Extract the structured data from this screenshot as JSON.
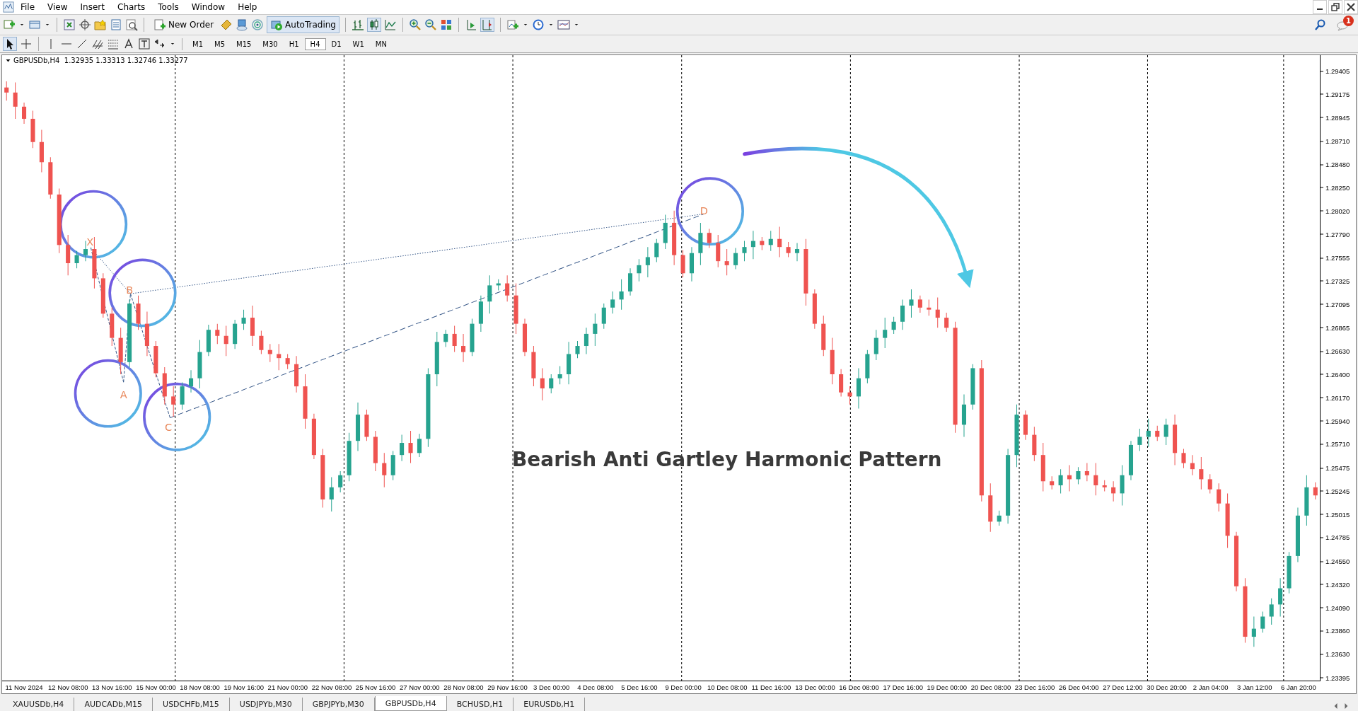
{
  "menu": [
    {
      "label": "File"
    },
    {
      "label": "View"
    },
    {
      "label": "Insert"
    },
    {
      "label": "Charts"
    },
    {
      "label": "Tools"
    },
    {
      "label": "Window"
    },
    {
      "label": "Help"
    }
  ],
  "toolbar": {
    "new_order": "New Order",
    "auto_trading": "AutoTrading"
  },
  "notification_badge": "1",
  "timeframes": [
    {
      "label": "M1",
      "selected": false
    },
    {
      "label": "M5",
      "selected": false
    },
    {
      "label": "M15",
      "selected": false
    },
    {
      "label": "M30",
      "selected": false
    },
    {
      "label": "H1",
      "selected": false
    },
    {
      "label": "H4",
      "selected": true
    },
    {
      "label": "D1",
      "selected": false
    },
    {
      "label": "W1",
      "selected": false
    },
    {
      "label": "MN",
      "selected": false
    }
  ],
  "chart": {
    "header": "GBPUSDb,H4  1.32935 1.33313 1.32746 1.33277",
    "title": "Bearish Anti Gartley Harmonic Pattern",
    "pattern_points": [
      {
        "label": "X"
      },
      {
        "label": "A"
      },
      {
        "label": "B"
      },
      {
        "label": "C"
      },
      {
        "label": "D"
      }
    ],
    "chart_data": {
      "type": "candlestick",
      "ylim": [
        1.23366,
        1.2956
      ],
      "yticks": [
        {
          "value": 1.29405,
          "label": "1.29405"
        },
        {
          "value": 1.29175,
          "label": "1.29175"
        },
        {
          "value": 1.28945,
          "label": "1.28945"
        },
        {
          "value": 1.2871,
          "label": "1.28710"
        },
        {
          "value": 1.2848,
          "label": "1.28480"
        },
        {
          "value": 1.2825,
          "label": "1.28250"
        },
        {
          "value": 1.2802,
          "label": "1.28020"
        },
        {
          "value": 1.2779,
          "label": "1.27790"
        },
        {
          "value": 1.27555,
          "label": "1.27555"
        },
        {
          "value": 1.27325,
          "label": "1.27325"
        },
        {
          "value": 1.27095,
          "label": "1.27095"
        },
        {
          "value": 1.26865,
          "label": "1.26865"
        },
        {
          "value": 1.2663,
          "label": "1.26630"
        },
        {
          "value": 1.264,
          "label": "1.26400"
        },
        {
          "value": 1.2617,
          "label": "1.26170"
        },
        {
          "value": 1.2594,
          "label": "1.25940"
        },
        {
          "value": 1.2571,
          "label": "1.25710"
        },
        {
          "value": 1.25475,
          "label": "1.25475"
        },
        {
          "value": 1.25245,
          "label": "1.25245"
        },
        {
          "value": 1.25015,
          "label": "1.25015"
        },
        {
          "value": 1.24785,
          "label": "1.24785"
        },
        {
          "value": 1.2455,
          "label": "1.24550"
        },
        {
          "value": 1.2432,
          "label": "1.24320"
        },
        {
          "value": 1.2409,
          "label": "1.24090"
        },
        {
          "value": 1.2386,
          "label": "1.23860"
        },
        {
          "value": 1.2363,
          "label": "1.23630"
        },
        {
          "value": 1.23395,
          "label": "1.23395"
        }
      ],
      "categories": [
        null,
        null,
        "11 Nov 2024",
        null,
        null,
        null,
        null,
        "12 Nov 08:00",
        null,
        null,
        null,
        null,
        "13 Nov 16:00",
        null,
        null,
        null,
        null,
        "15 Nov 00:00",
        null,
        null,
        null,
        null,
        "18 Nov 08:00",
        null,
        null,
        null,
        null,
        "19 Nov 16:00",
        null,
        null,
        null,
        null,
        "21 Nov 00:00",
        null,
        null,
        null,
        null,
        "22 Nov 08:00",
        null,
        null,
        null,
        null,
        "25 Nov 16:00",
        null,
        null,
        null,
        null,
        "27 Nov 00:00",
        null,
        null,
        null,
        null,
        "28 Nov 08:00",
        null,
        null,
        null,
        null,
        "29 Nov 16:00",
        null,
        null,
        null,
        null,
        "3 Dec 00:00",
        null,
        null,
        null,
        null,
        "4 Dec 08:00",
        null,
        null,
        null,
        null,
        "5 Dec 16:00",
        null,
        null,
        null,
        null,
        "9 Dec 00:00",
        null,
        null,
        null,
        null,
        "10 Dec 08:00",
        null,
        null,
        null,
        null,
        "11 Dec 16:00",
        null,
        null,
        null,
        null,
        "13 Dec 00:00",
        null,
        null,
        null,
        null,
        "16 Dec 08:00",
        null,
        null,
        null,
        null,
        "17 Dec 16:00",
        null,
        null,
        null,
        null,
        "19 Dec 00:00",
        null,
        null,
        null,
        null,
        "20 Dec 08:00",
        null,
        null,
        null,
        null,
        "23 Dec 16:00",
        null,
        null,
        null,
        null,
        "26 Dec 04:00",
        null,
        null,
        null,
        null,
        "27 Dec 12:00",
        null,
        null,
        null,
        null,
        "30 Dec 20:00",
        null,
        null,
        null,
        null,
        "2 Jan 04:00",
        null,
        null,
        null,
        null,
        "3 Jan 12:00",
        null,
        null,
        null,
        null,
        "6 Jan 20:00",
        null,
        null
      ],
      "ohlc": [
        [
          1.2924,
          1.293,
          1.2911,
          1.2919
        ],
        [
          1.2919,
          1.2929,
          1.2893,
          1.2905
        ],
        [
          1.2905,
          1.2909,
          1.2888,
          1.2893
        ],
        [
          1.2893,
          1.2901,
          1.2864,
          1.287
        ],
        [
          1.287,
          1.2882,
          1.284,
          1.285
        ],
        [
          1.285,
          1.2855,
          1.2814,
          1.2818
        ],
        [
          1.2818,
          1.2824,
          1.276,
          1.2768
        ],
        [
          1.2768,
          1.2778,
          1.2738,
          1.275
        ],
        [
          1.275,
          1.2762,
          1.2745,
          1.2758
        ],
        [
          1.2758,
          1.2772,
          1.2752,
          1.2764
        ],
        [
          1.2764,
          1.2776,
          1.2725,
          1.2735
        ],
        [
          1.2735,
          1.274,
          1.2696,
          1.27
        ],
        [
          1.27,
          1.2706,
          1.2668,
          1.2676
        ],
        [
          1.2676,
          1.2686,
          1.264,
          1.2652
        ],
        [
          1.2652,
          1.2714,
          1.2647,
          1.271
        ],
        [
          1.271,
          1.2718,
          1.2684,
          1.269
        ],
        [
          1.269,
          1.2702,
          1.2658,
          1.2668
        ],
        [
          1.2668,
          1.2673,
          1.2637,
          1.2641
        ],
        [
          1.2641,
          1.2647,
          1.261,
          1.2618
        ],
        [
          1.2618,
          1.2628,
          1.2598,
          1.261
        ],
        [
          1.261,
          1.2632,
          1.2605,
          1.2628
        ],
        [
          1.2628,
          1.2644,
          1.2622,
          1.2636
        ],
        [
          1.2636,
          1.2674,
          1.2626,
          1.2662
        ],
        [
          1.2662,
          1.2689,
          1.2658,
          1.2684
        ],
        [
          1.2684,
          1.269,
          1.267,
          1.2678
        ],
        [
          1.2678,
          1.2688,
          1.2658,
          1.267
        ],
        [
          1.267,
          1.2694,
          1.2665,
          1.269
        ],
        [
          1.269,
          1.2704,
          1.2684,
          1.2696
        ],
        [
          1.2696,
          1.2708,
          1.2668,
          1.2678
        ],
        [
          1.2678,
          1.2683,
          1.266,
          1.2664
        ],
        [
          1.2664,
          1.267,
          1.2652,
          1.266
        ],
        [
          1.266,
          1.267,
          1.2644,
          1.2656
        ],
        [
          1.2656,
          1.266,
          1.2645,
          1.265
        ],
        [
          1.265,
          1.2658,
          1.2622,
          1.2628
        ],
        [
          1.2628,
          1.264,
          1.2586,
          1.2596
        ],
        [
          1.2596,
          1.2601,
          1.2556,
          1.256
        ],
        [
          1.256,
          1.2566,
          1.2508,
          1.2516
        ],
        [
          1.2516,
          1.2538,
          1.2504,
          1.2528
        ],
        [
          1.2528,
          1.2544,
          1.2523,
          1.254
        ],
        [
          1.254,
          1.2582,
          1.2534,
          1.2574
        ],
        [
          1.2574,
          1.2612,
          1.2564,
          1.26
        ],
        [
          1.26,
          1.2605,
          1.2574,
          1.2578
        ],
        [
          1.2578,
          1.2584,
          1.2544,
          1.2552
        ],
        [
          1.2552,
          1.2562,
          1.2528,
          1.254
        ],
        [
          1.254,
          1.2564,
          1.2535,
          1.256
        ],
        [
          1.256,
          1.258,
          1.2554,
          1.2572
        ],
        [
          1.2572,
          1.2584,
          1.2552,
          1.2562
        ],
        [
          1.2562,
          1.2581,
          1.2558,
          1.2576
        ],
        [
          1.2576,
          1.2646,
          1.2568,
          1.264
        ],
        [
          1.264,
          1.2682,
          1.2628,
          1.2672
        ],
        [
          1.2672,
          1.2684,
          1.2667,
          1.268
        ],
        [
          1.268,
          1.2688,
          1.2662,
          1.2668
        ],
        [
          1.2668,
          1.268,
          1.2652,
          1.2662
        ],
        [
          1.2662,
          1.2695,
          1.2658,
          1.269
        ],
        [
          1.269,
          1.2718,
          1.2682,
          1.2712
        ],
        [
          1.2712,
          1.2738,
          1.27,
          1.2728
        ],
        [
          1.2728,
          1.2734,
          1.2723,
          1.273
        ],
        [
          1.273,
          1.2738,
          1.2712,
          1.2718
        ],
        [
          1.2718,
          1.273,
          1.268,
          1.269
        ],
        [
          1.269,
          1.2695,
          1.2658,
          1.2662
        ],
        [
          1.2662,
          1.2668,
          1.2628,
          1.2636
        ],
        [
          1.2636,
          1.2646,
          1.2614,
          1.2626
        ],
        [
          1.2626,
          1.264,
          1.2621,
          1.2636
        ],
        [
          1.2636,
          1.2648,
          1.263,
          1.264
        ],
        [
          1.264,
          1.2672,
          1.263,
          1.266
        ],
        [
          1.266,
          1.2673,
          1.2656,
          1.2668
        ],
        [
          1.2668,
          1.2686,
          1.266,
          1.268
        ],
        [
          1.268,
          1.27,
          1.2668,
          1.269
        ],
        [
          1.269,
          1.271,
          1.2685,
          1.2706
        ],
        [
          1.2706,
          1.2722,
          1.27,
          1.2714
        ],
        [
          1.2714,
          1.2734,
          1.2704,
          1.2722
        ],
        [
          1.2722,
          1.2745,
          1.2718,
          1.274
        ],
        [
          1.274,
          1.2754,
          1.2732,
          1.2748
        ],
        [
          1.2748,
          1.2766,
          1.2736,
          1.2756
        ],
        [
          1.2756,
          1.2774,
          1.2751,
          1.277
        ],
        [
          1.277,
          1.2798,
          1.2764,
          1.279
        ],
        [
          1.279,
          1.2802,
          1.2748,
          1.2758
        ],
        [
          1.2758,
          1.2763,
          1.2736,
          1.274
        ],
        [
          1.274,
          1.2766,
          1.2732,
          1.276
        ],
        [
          1.276,
          1.279,
          1.2748,
          1.278
        ],
        [
          1.278,
          1.2784,
          1.2765,
          1.277
        ],
        [
          1.277,
          1.2778,
          1.2746,
          1.2752
        ],
        [
          1.2752,
          1.2764,
          1.2738,
          1.2748
        ],
        [
          1.2748,
          1.2765,
          1.2744,
          1.276
        ],
        [
          1.276,
          1.2772,
          1.2752,
          1.2766
        ],
        [
          1.2766,
          1.2782,
          1.2754,
          1.2772
        ],
        [
          1.2772,
          1.2776,
          1.2763,
          1.2768
        ],
        [
          1.2768,
          1.2782,
          1.2762,
          1.2774
        ],
        [
          1.2774,
          1.2786,
          1.2756,
          1.2766
        ],
        [
          1.2766,
          1.2771,
          1.2756,
          1.276
        ],
        [
          1.276,
          1.277,
          1.2752,
          1.2764
        ],
        [
          1.2764,
          1.2774,
          1.2708,
          1.272
        ],
        [
          1.272,
          1.2724,
          1.2685,
          1.269
        ],
        [
          1.269,
          1.2698,
          1.2658,
          1.2664
        ],
        [
          1.2664,
          1.2676,
          1.263,
          1.264
        ],
        [
          1.264,
          1.2645,
          1.2618,
          1.2622
        ],
        [
          1.2622,
          1.2628,
          1.261,
          1.2618
        ],
        [
          1.2618,
          1.2646,
          1.2606,
          1.2636
        ],
        [
          1.2636,
          1.2664,
          1.2631,
          1.266
        ],
        [
          1.266,
          1.2684,
          1.2654,
          1.2676
        ],
        [
          1.2676,
          1.2696,
          1.2666,
          1.2684
        ],
        [
          1.2684,
          1.2697,
          1.268,
          1.2692
        ],
        [
          1.2692,
          1.2714,
          1.2684,
          1.2708
        ],
        [
          1.2708,
          1.2724,
          1.2696,
          1.2714
        ],
        [
          1.2714,
          1.2718,
          1.2701,
          1.2706
        ],
        [
          1.2706,
          1.2714,
          1.2698,
          1.2704
        ],
        [
          1.2704,
          1.2716,
          1.2686,
          1.2696
        ],
        [
          1.2696,
          1.2701,
          1.2682,
          1.2686
        ],
        [
          1.2686,
          1.2692,
          1.2582,
          1.259
        ],
        [
          1.259,
          1.262,
          1.2578,
          1.261
        ],
        [
          1.261,
          1.265,
          1.2605,
          1.2646
        ],
        [
          1.2646,
          1.2654,
          1.2514,
          1.252
        ],
        [
          1.252,
          1.2532,
          1.2484,
          1.2494
        ],
        [
          1.2494,
          1.2505,
          1.249,
          1.25
        ],
        [
          1.25,
          1.2566,
          1.2492,
          1.256
        ],
        [
          1.256,
          1.261,
          1.2548,
          1.26
        ],
        [
          1.26,
          1.2604,
          1.2575,
          1.258
        ],
        [
          1.258,
          1.2588,
          1.2554,
          1.256
        ],
        [
          1.256,
          1.2572,
          1.2524,
          1.2534
        ],
        [
          1.2534,
          1.2539,
          1.2526,
          1.253
        ],
        [
          1.253,
          1.2546,
          1.2522,
          1.254
        ],
        [
          1.254,
          1.255,
          1.2524,
          1.2536
        ],
        [
          1.2536,
          1.2548,
          1.2531,
          1.2544
        ],
        [
          1.2544,
          1.2552,
          1.2534,
          1.254
        ],
        [
          1.254,
          1.2552,
          1.252,
          1.253
        ],
        [
          1.253,
          1.2535,
          1.2524,
          1.2528
        ],
        [
          1.2528,
          1.2534,
          1.2514,
          1.2522
        ],
        [
          1.2522,
          1.255,
          1.251,
          1.254
        ],
        [
          1.254,
          1.2574,
          1.2535,
          1.257
        ],
        [
          1.257,
          1.2586,
          1.2564,
          1.2578
        ],
        [
          1.2578,
          1.2596,
          1.2568,
          1.2584
        ],
        [
          1.2584,
          1.2589,
          1.2574,
          1.2578
        ],
        [
          1.2578,
          1.2596,
          1.257,
          1.259
        ],
        [
          1.259,
          1.26,
          1.255,
          1.2562
        ],
        [
          1.2562,
          1.2566,
          1.2547,
          1.2552
        ],
        [
          1.2552,
          1.256,
          1.254,
          1.2546
        ],
        [
          1.2546,
          1.2558,
          1.2526,
          1.2536
        ],
        [
          1.2536,
          1.2541,
          1.2522,
          1.2526
        ],
        [
          1.2526,
          1.2532,
          1.2504,
          1.2512
        ],
        [
          1.2512,
          1.2522,
          1.2468,
          1.248
        ],
        [
          1.248,
          1.2484,
          1.2425,
          1.243
        ],
        [
          1.243,
          1.2438,
          1.2374,
          1.238
        ],
        [
          1.238,
          1.24,
          1.237,
          1.2388
        ],
        [
          1.2388,
          1.2405,
          1.2384,
          1.24
        ],
        [
          1.24,
          1.2418,
          1.2392,
          1.2412
        ],
        [
          1.2412,
          1.2438,
          1.24,
          1.2428
        ],
        [
          1.2428,
          1.2464,
          1.2423,
          1.246
        ],
        [
          1.246,
          1.2508,
          1.2454,
          1.25
        ],
        [
          1.25,
          1.254,
          1.249,
          1.2528
        ],
        [
          1.2528,
          1.2533,
          1.2516,
          1.252
        ]
      ]
    }
  },
  "tabs": [
    {
      "label": "XAUUSDb,H4",
      "selected": false
    },
    {
      "label": "AUDCADb,M15",
      "selected": false
    },
    {
      "label": "USDCHFb,M15",
      "selected": false
    },
    {
      "label": "USDJPYb,M30",
      "selected": false
    },
    {
      "label": "GBPJPYb,M30",
      "selected": false
    },
    {
      "label": "GBPUSDb,H4",
      "selected": true
    },
    {
      "label": "BCHUSD,H1",
      "selected": false
    },
    {
      "label": "EURUSDb,H1",
      "selected": false
    }
  ]
}
